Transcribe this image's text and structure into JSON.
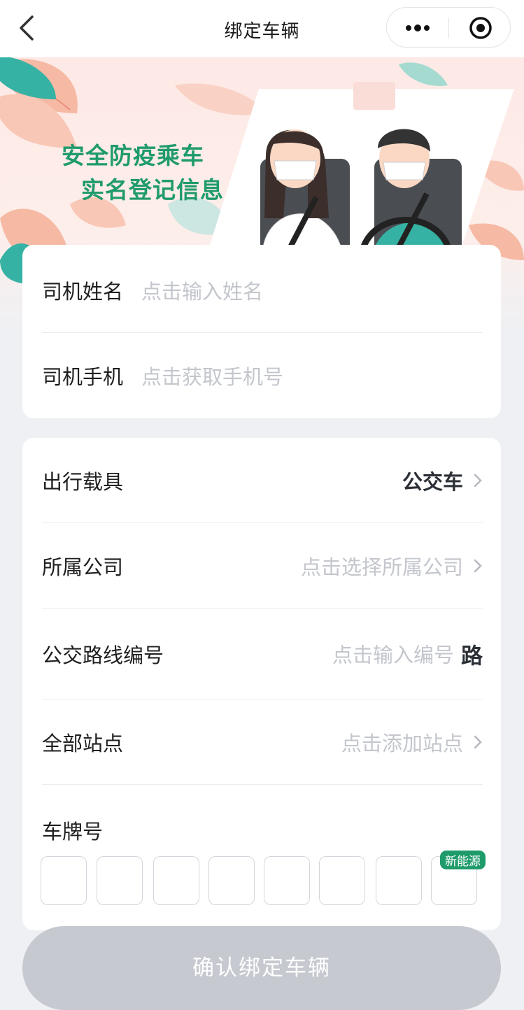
{
  "nav": {
    "title": "绑定车辆"
  },
  "banner": {
    "line1": "安全防疫乘车",
    "line2": "实名登记信息"
  },
  "driver_card": {
    "name_label": "司机姓名",
    "name_placeholder": "点击输入姓名",
    "phone_label": "司机手机",
    "phone_placeholder": "点击获取手机号"
  },
  "vehicle_card": {
    "vehicle_type_label": "出行载具",
    "vehicle_type_value": "公交车",
    "company_label": "所属公司",
    "company_placeholder": "点击选择所属公司",
    "route_label": "公交路线编号",
    "route_placeholder": "点击输入编号",
    "route_suffix": "路",
    "stations_label": "全部站点",
    "stations_placeholder": "点击添加站点",
    "plate_label": "车牌号",
    "plate_box_count": 8,
    "new_energy_badge": "新能源"
  },
  "confirm_button": "确认绑定车辆",
  "colors": {
    "accent_green": "#1f9b6b",
    "placeholder_gray": "#c3c6cc",
    "button_disabled": "#c6c9d0",
    "page_bg": "#eef0f4"
  }
}
